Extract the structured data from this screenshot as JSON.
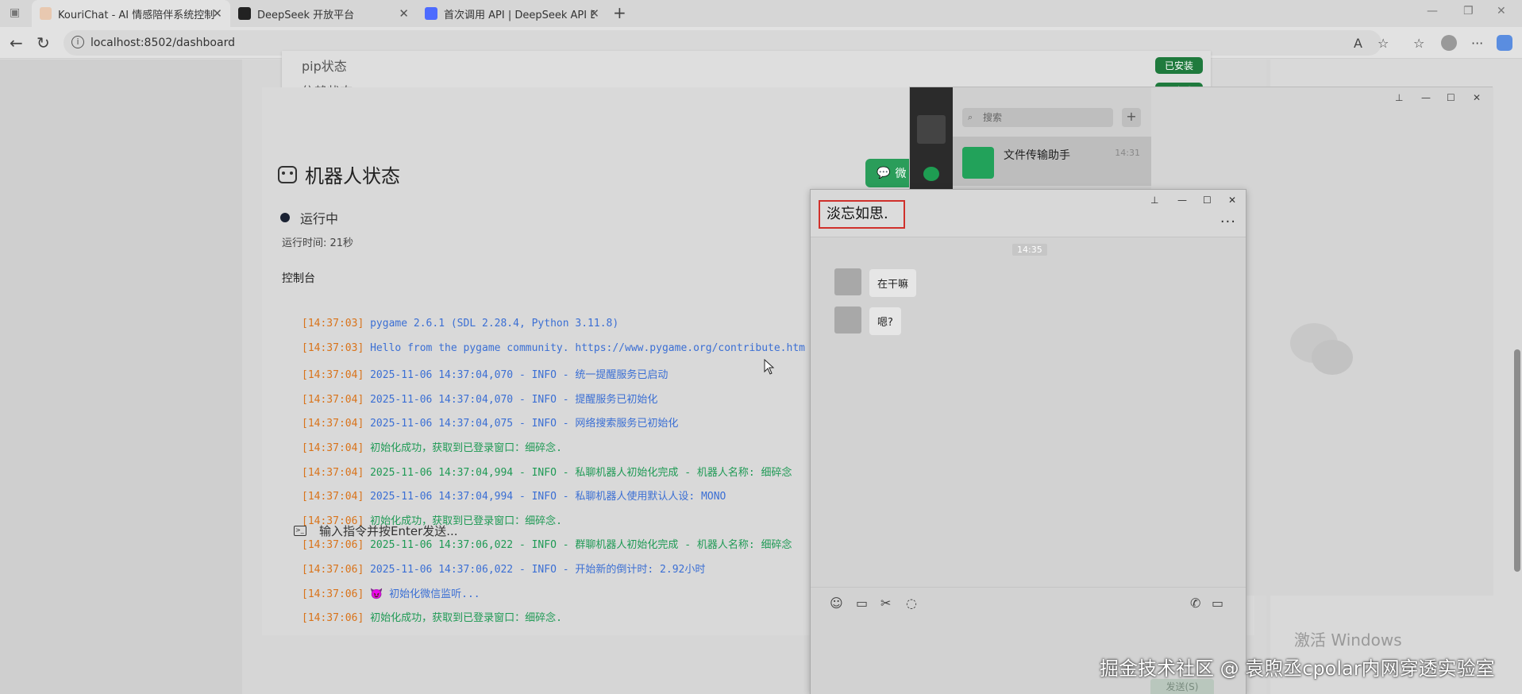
{
  "browser": {
    "tabs": [
      {
        "title": "KouriChat - AI 情感陪伴系统控制",
        "active": true
      },
      {
        "title": "DeepSeek 开放平台",
        "active": false
      },
      {
        "title": "首次调用 API | DeepSeek API Doc",
        "active": false
      }
    ],
    "url": "localhost:8502/dashboard"
  },
  "dependencies": {
    "pip_label": "pip状态",
    "pip_badge": "已安装",
    "dep_label": "依赖状态",
    "dep_badge": "已完成"
  },
  "robot": {
    "title": "机器人状态",
    "wechat_button": "微",
    "status": "运行中",
    "runtime": "运行时间: 21秒",
    "console_label": "控制台",
    "command_placeholder": "输入指令并按Enter发送..."
  },
  "console_logs": [
    {
      "ts": "[14:37:03]",
      "text": "pygame 2.6.1 (SDL 2.28.4, Python 3.11.8)",
      "color": "blue"
    },
    {
      "ts": "[14:37:03]",
      "text": "Hello from the pygame community. https://www.pygame.org/contribute.htm",
      "color": "blue"
    },
    {
      "ts": "[14:37:04]",
      "text": "2025-11-06 14:37:04,070 - INFO - 统一提醒服务已启动",
      "color": "blue"
    },
    {
      "ts": "[14:37:04]",
      "text": "2025-11-06 14:37:04,070 - INFO - 提醒服务已初始化",
      "color": "blue"
    },
    {
      "ts": "[14:37:04]",
      "text": "2025-11-06 14:37:04,075 - INFO - 网络搜索服务已初始化",
      "color": "blue"
    },
    {
      "ts": "[14:37:04]",
      "text": "初始化成功，获取到已登录窗口：细碎念.",
      "color": "green"
    },
    {
      "ts": "[14:37:04]",
      "text": "2025-11-06 14:37:04,994 - INFO - 私聊机器人初始化完成 - 机器人名称: 细碎念",
      "color": "green"
    },
    {
      "ts": "[14:37:04]",
      "text": "2025-11-06 14:37:04,994 - INFO - 私聊机器人使用默认人设: MONO",
      "color": "blue"
    },
    {
      "ts": "[14:37:06]",
      "text": "初始化成功，获取到已登录窗口：细碎念.",
      "color": "green"
    },
    {
      "ts": "[14:37:06]",
      "text": "2025-11-06 14:37:06,022 - INFO - 群聊机器人初始化完成 - 机器人名称: 细碎念",
      "color": "green"
    },
    {
      "ts": "[14:37:06]",
      "text": "2025-11-06 14:37:06,022 - INFO - 开始新的倒计时: 2.92小时",
      "color": "blue"
    },
    {
      "ts": "[14:37:06]",
      "text": "😈 初始化微信监听...",
      "color": "blue"
    },
    {
      "ts": "[14:37:06]",
      "text": "初始化成功，获取到已登录窗口：细碎念.",
      "color": "green"
    }
  ],
  "wechat": {
    "search_placeholder": "搜索",
    "contact_name": "文件传输助手",
    "contact_time": "14:31",
    "activate_text": "激活 Windows"
  },
  "chat": {
    "title": "淡忘如思.",
    "time_divider": "14:35",
    "messages": [
      "在干嘛",
      "嗯?"
    ],
    "send_label": "发送(S)"
  },
  "watermark": "掘金技术社区 @ 袁煦丞cpolar内网穿透实验室"
}
